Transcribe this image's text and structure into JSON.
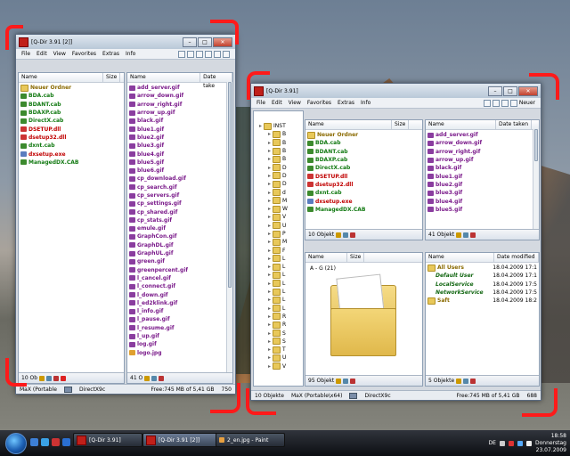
{
  "window_left": {
    "title": "[Q-Dir 3.91 [2]]",
    "menu": [
      "File",
      "Edit",
      "View",
      "Favorites",
      "Extras",
      "Info"
    ],
    "pane1": {
      "columns": [
        "Name",
        "Size"
      ],
      "items": [
        {
          "name": "Neuer Ordner",
          "type": "folder"
        },
        {
          "name": "BDA.cab",
          "type": "cab"
        },
        {
          "name": "BDANT.cab",
          "type": "cab"
        },
        {
          "name": "BDAXP.cab",
          "type": "cab"
        },
        {
          "name": "DirectX.cab",
          "type": "cab"
        },
        {
          "name": "DSETUP.dll",
          "type": "dll"
        },
        {
          "name": "dsetup32.dll",
          "type": "dll"
        },
        {
          "name": "dxnt.cab",
          "type": "cab"
        },
        {
          "name": "dxsetup.exe",
          "type": "exe"
        },
        {
          "name": "ManagedDX.CAB",
          "type": "cab"
        }
      ],
      "status": "10 Ob"
    },
    "pane2": {
      "columns": [
        "Name",
        "Date take"
      ],
      "items": [
        "add_server.gif",
        "arrow_down.gif",
        "arrow_right.gif",
        "arrow_up.gif",
        "black.gif",
        "blue1.gif",
        "blue2.gif",
        "blue3.gif",
        "blue4.gif",
        "blue5.gif",
        "blue6.gif",
        "cp_download.gif",
        "cp_search.gif",
        "cp_servers.gif",
        "cp_settings.gif",
        "cp_shared.gif",
        "cp_stats.gif",
        "emule.gif",
        "GraphCon.gif",
        "GraphDL.gif",
        "GraphUL.gif",
        "green.gif",
        "greenpercent.gif",
        "l_cancel.gif",
        "l_connect.gif",
        "l_down.gif",
        "l_ed2klink.gif",
        "l_info.gif",
        "l_pause.gif",
        "l_resume.gif",
        "l_up.gif",
        "log.gif",
        "logo.jpg"
      ],
      "status": "41 O"
    },
    "statusbar": {
      "path": "MaX (Portable",
      "folder": "DirectX9c",
      "free": "Free:745 MB of 5,41 GB",
      "size": "750"
    }
  },
  "window_right": {
    "title": "[Q-Dir 3.91]",
    "menu": [
      "File",
      "Edit",
      "View",
      "Favorites",
      "Extras",
      "Info"
    ],
    "menu_extra": "Neuer",
    "tree": {
      "items": [
        "INST",
        "B",
        "B",
        "B",
        "B",
        "D",
        "D",
        "D",
        "d",
        "M",
        "W",
        "V",
        "U",
        "P",
        "M",
        "F",
        "L",
        "L",
        "L",
        "L",
        "L",
        "L",
        "L",
        "R",
        "R",
        "S",
        "S",
        "T",
        "U",
        "V"
      ]
    },
    "pane1": {
      "columns": [
        "Name",
        "Size"
      ],
      "items": [
        {
          "name": "Neuer Ordner",
          "type": "folder"
        },
        {
          "name": "BDA.cab",
          "type": "cab"
        },
        {
          "name": "BDANT.cab",
          "type": "cab"
        },
        {
          "name": "BDAXP.cab",
          "type": "cab"
        },
        {
          "name": "DirectX.cab",
          "type": "cab"
        },
        {
          "name": "DSETUP.dll",
          "type": "dll"
        },
        {
          "name": "dsetup32.dll",
          "type": "dll"
        },
        {
          "name": "dxnt.cab",
          "type": "cab"
        },
        {
          "name": "dxsetup.exe",
          "type": "exe"
        },
        {
          "name": "ManagedDX.CAB",
          "type": "cab"
        }
      ],
      "status": "10 Objekt"
    },
    "pane2": {
      "columns": [
        "Name",
        "Date taken"
      ],
      "items": [
        "add_server.gif",
        "arrow_down.gif",
        "arrow_right.gif",
        "arrow_up.gif",
        "black.gif",
        "blue1.gif",
        "blue2.gif",
        "blue3.gif",
        "blue4.gif",
        "blue5.gif"
      ],
      "status": "41 Objekt"
    },
    "pane3": {
      "columns": [
        "Name",
        "Size"
      ],
      "group": "A - G (21)",
      "status": "95 Objekt"
    },
    "pane4": {
      "columns": [
        "Name",
        "Date modified"
      ],
      "items": [
        {
          "name": "All Users",
          "date": "18.04.2009 17:1"
        },
        {
          "name": "Default User",
          "date": "18.04.2009 17:1"
        },
        {
          "name": "LocalService",
          "date": "18.04.2009 17:5"
        },
        {
          "name": "NetworkService",
          "date": "18.04.2009 17:5"
        },
        {
          "name": "Saft",
          "date": "18.04.2009 18:2"
        }
      ],
      "status": "5 Objekte"
    },
    "statusbar": {
      "count": "10 Objekte",
      "path": "MaX (Portable\\x64)",
      "folder": "DirectX9c",
      "free": "Free:745 MB of 5,41 GB",
      "size": "688"
    }
  },
  "taskbar": {
    "buttons": [
      "[Q-Dir 3.91]",
      "[Q-Dir 3.91 [2]]",
      "2_en.jpg - Paint"
    ],
    "lang": "DE",
    "time": "18:58",
    "day": "Donnerstag",
    "date": "23.07.2009"
  },
  "colors": {
    "annotation": "#ff1a1a",
    "folder": "#e8c85a",
    "cab": "#137a13",
    "dll": "#c00000",
    "gif": "#7a1a8a"
  }
}
